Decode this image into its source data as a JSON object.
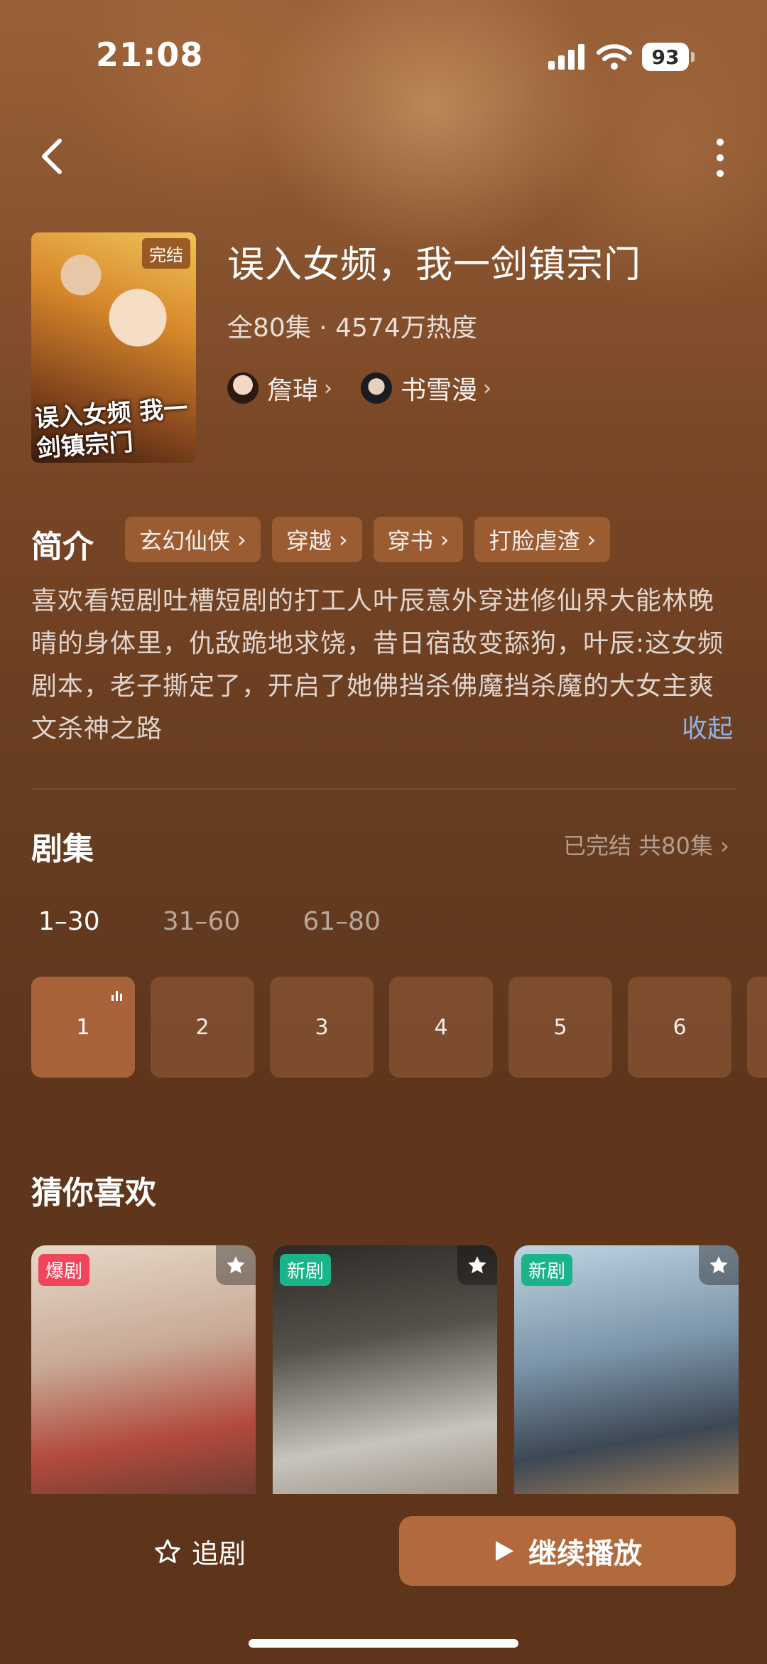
{
  "status_bar": {
    "time": "21:08",
    "battery": "93"
  },
  "show": {
    "poster_badge": "完结",
    "poster_title": "误入女频 我一剑镇宗门",
    "title": "误入女频，我一剑镇宗门",
    "meta": "全80集 · 4574万热度",
    "cast": [
      {
        "name": "詹琸"
      },
      {
        "name": "书雪漫"
      }
    ]
  },
  "synopsis": {
    "label": "简介",
    "tags": [
      "玄幻仙侠",
      "穿越",
      "穿书",
      "打脸虐渣"
    ],
    "text": "喜欢看短剧吐槽短剧的打工人叶辰意外穿进修仙界大能林晚晴的身体里，仇敌跪地求饶，昔日宿敌变舔狗，叶辰:这女频剧本，老子撕定了，开启了她佛挡杀佛魔挡杀魔的大女主爽文杀神之路",
    "collapse": "收起"
  },
  "episodes": {
    "label": "剧集",
    "status": "已完结 共80集",
    "ranges": [
      "1–30",
      "31–60",
      "61–80"
    ],
    "items": [
      "1",
      "2",
      "3",
      "4",
      "5",
      "6"
    ]
  },
  "recommendations": {
    "label": "猜你喜欢",
    "cards": [
      {
        "badge": "爆剧"
      },
      {
        "badge": "新剧"
      },
      {
        "badge": "新剧"
      }
    ]
  },
  "bottom": {
    "follow_label": "追剧",
    "play_label": "继续播放"
  }
}
